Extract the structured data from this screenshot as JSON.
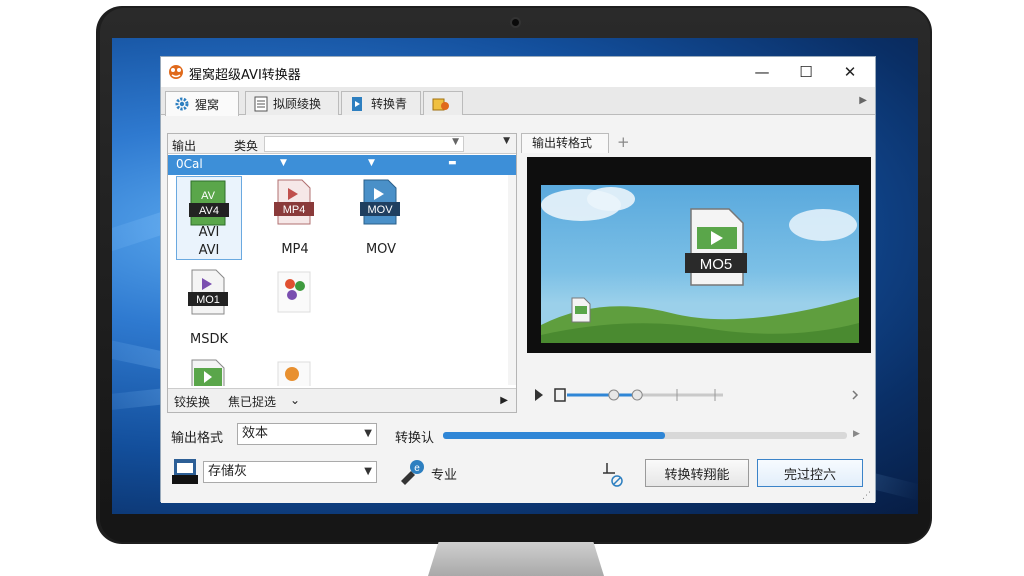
{
  "window": {
    "title": "猩窝超级AVI转换器",
    "controls": {
      "minimize": "—",
      "maximize": "☐",
      "close": "✕"
    }
  },
  "tabs": [
    {
      "label": "猩窝",
      "icon": "gear-icon",
      "active": true
    },
    {
      "label": "拟顾绫换",
      "icon": "document-icon",
      "active": false
    },
    {
      "label": "转换青",
      "icon": "convert-icon",
      "active": false
    },
    {
      "label": "",
      "icon": "tools-icon",
      "active": false
    }
  ],
  "left_panel": {
    "category_label": "输出",
    "category_value": "类奂",
    "filter_text": "0Cal",
    "formats": [
      {
        "badge": "AV4",
        "label": "AVI",
        "icon_title": "AV",
        "color": "#3e9a3e",
        "selected": true
      },
      {
        "badge": "MP4",
        "label": "MP4",
        "color": "#c0504d",
        "selected": false
      },
      {
        "badge": "MOV",
        "label": "MOV",
        "color": "#2d7fc0",
        "selected": false
      },
      {
        "badge": "MO1",
        "label": "MSDK",
        "color": "#7a4fb0",
        "selected": false
      },
      {
        "badge": "",
        "label": "",
        "color": "#e05030",
        "selected": false
      },
      {
        "badge": "",
        "label": "",
        "color": "#3e9a3e",
        "selected": false
      },
      {
        "badge": "",
        "label": "",
        "color": "#e89030",
        "selected": false
      }
    ],
    "footer_left": "铰挨换",
    "footer_right": "焦已捉选"
  },
  "right_panel": {
    "tab_label": "输出转格式",
    "preview_badge": "MO5"
  },
  "player": {
    "progress_fraction": 0.3,
    "slider_fraction": 0.45
  },
  "bottom": {
    "format_label": "输出格式",
    "format_value": "效本",
    "convert_label": "转换认",
    "convert_progress": 0.55,
    "preset_value": "存储灰",
    "pro_label": "专业",
    "convert_button": "转换转翔能",
    "complete_button": "完过控六"
  }
}
